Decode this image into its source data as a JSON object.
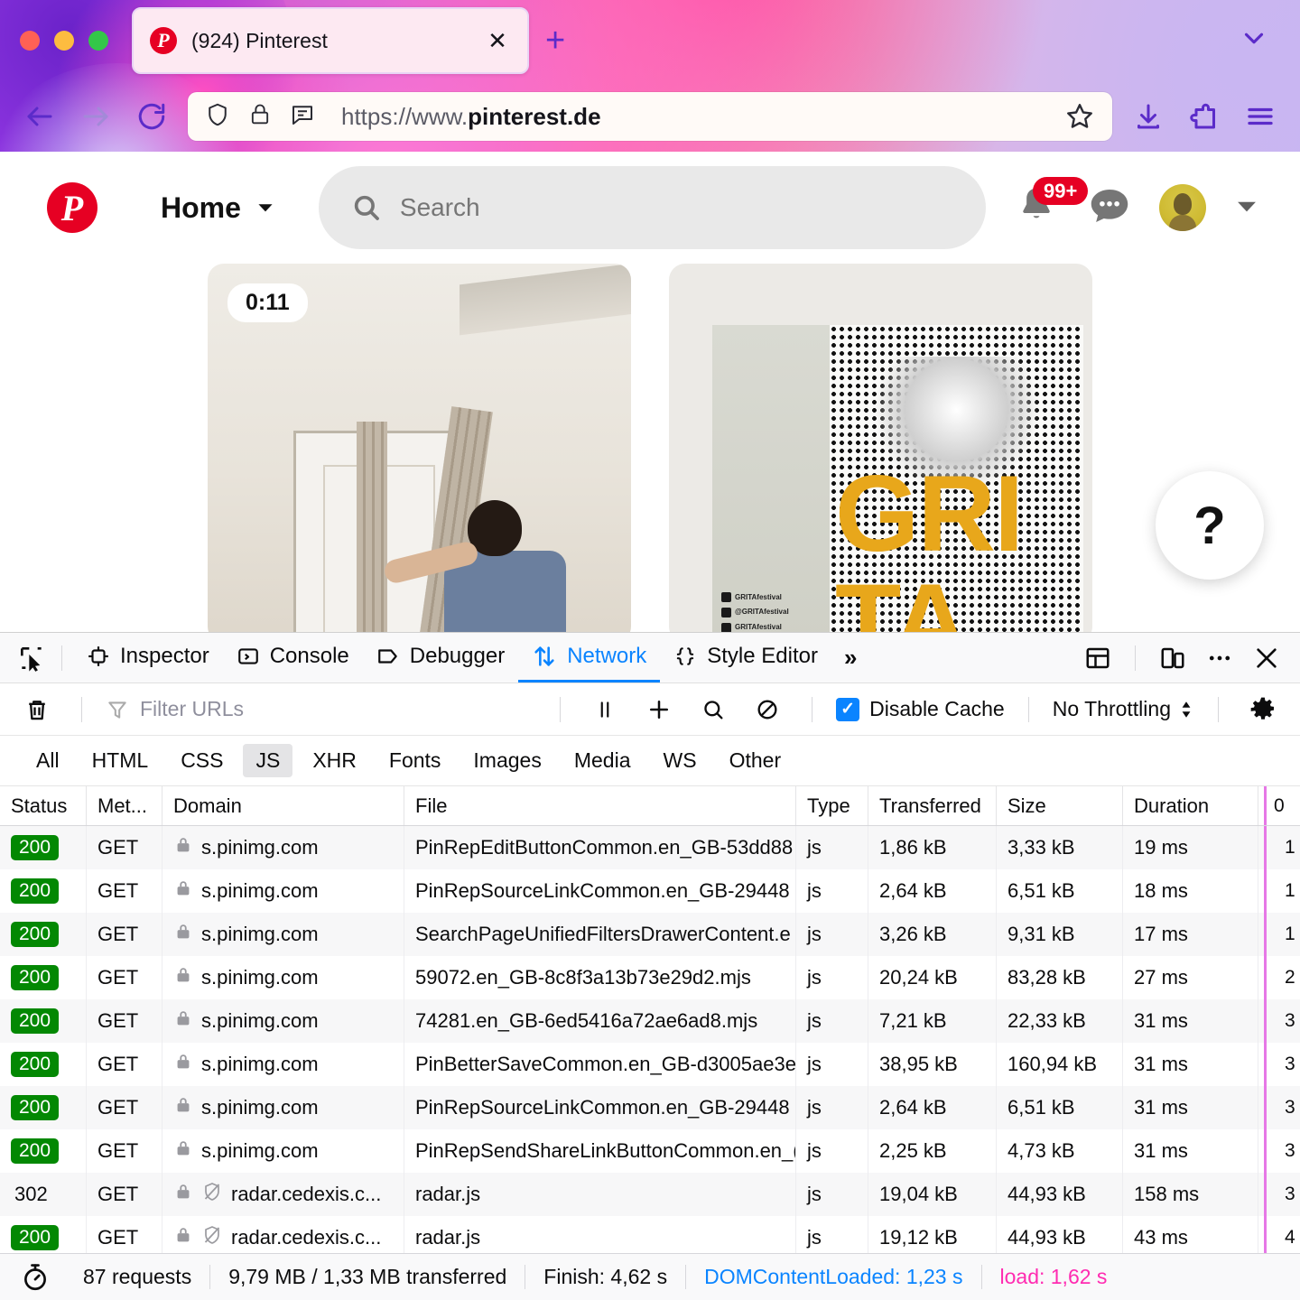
{
  "browser": {
    "tab": {
      "title": "(924) Pinterest",
      "favicon": "pinterest-icon",
      "close": "✕"
    },
    "new_tab_label": "+",
    "url": {
      "prefix": "https://www.",
      "domain": "pinterest.de"
    },
    "nav": {
      "back": "back-icon",
      "forward": "forward-icon",
      "reload": "reload-icon"
    },
    "url_icons": [
      "shield-icon",
      "lock-icon",
      "reader-icon"
    ],
    "toolbar_icons": [
      "bookmark-star-icon",
      "downloads-icon",
      "extensions-icon",
      "app-menu-icon"
    ]
  },
  "pinterest": {
    "home_label": "Home",
    "search_placeholder": "Search",
    "notifications_badge": "99+",
    "pins": [
      {
        "duration": "0:11",
        "type": "video"
      },
      {
        "poster_text_1": "GRI",
        "poster_text_2": "TA",
        "socials": [
          "GRITAfestival",
          "@GRITAfestival",
          "GRITAfestival"
        ]
      }
    ],
    "help_label": "?"
  },
  "devtools": {
    "tabs": [
      {
        "label": "Inspector",
        "icon": "inspector-icon",
        "active": false
      },
      {
        "label": "Console",
        "icon": "console-icon",
        "active": false
      },
      {
        "label": "Debugger",
        "icon": "debugger-icon",
        "active": false
      },
      {
        "label": "Network",
        "icon": "network-icon",
        "active": true
      },
      {
        "label": "Style Editor",
        "icon": "style-editor-icon",
        "active": false
      }
    ],
    "more_tabs": "»",
    "right_icons": [
      "dock-layout-icon",
      "responsive-design-icon",
      "meatball-menu-icon",
      "close-icon"
    ],
    "filter_placeholder": "Filter URLs",
    "disable_cache_label": "Disable Cache",
    "disable_cache_checked": true,
    "throttling_label": "No Throttling",
    "type_filters": [
      "All",
      "HTML",
      "CSS",
      "JS",
      "XHR",
      "Fonts",
      "Images",
      "Media",
      "WS",
      "Other"
    ],
    "active_type_filter": "JS",
    "columns": [
      "Status",
      "Met...",
      "Domain",
      "File",
      "Type",
      "Transferred",
      "Size",
      "Duration",
      "0"
    ],
    "rows": [
      {
        "status": "200",
        "method": "GET",
        "domain": "s.pinimg.com",
        "secure": true,
        "blocked": false,
        "file": "PinRepEditButtonCommon.en_GB-53dd88",
        "type": "js",
        "transferred": "1,86 kB",
        "size": "3,33 kB",
        "duration": "19 ms",
        "wf_color": "#8e9bb3",
        "wf_num": "1"
      },
      {
        "status": "200",
        "method": "GET",
        "domain": "s.pinimg.com",
        "secure": true,
        "blocked": false,
        "file": "PinRepSourceLinkCommon.en_GB-29448",
        "type": "js",
        "transferred": "2,64 kB",
        "size": "6,51 kB",
        "duration": "18 ms",
        "wf_color": "#8e9bb3",
        "wf_num": "1"
      },
      {
        "status": "200",
        "method": "GET",
        "domain": "s.pinimg.com",
        "secure": true,
        "blocked": false,
        "file": "SearchPageUnifiedFiltersDrawerContent.e",
        "type": "js",
        "transferred": "3,26 kB",
        "size": "9,31 kB",
        "duration": "17 ms",
        "wf_color": "#8e9bb3",
        "wf_num": "1"
      },
      {
        "status": "200",
        "method": "GET",
        "domain": "s.pinimg.com",
        "secure": true,
        "blocked": false,
        "file": "59072.en_GB-8c8f3a13b73e29d2.mjs",
        "type": "js",
        "transferred": "20,24 kB",
        "size": "83,28 kB",
        "duration": "27 ms",
        "wf_color": "#5bb55b",
        "wf_num": "2"
      },
      {
        "status": "200",
        "method": "GET",
        "domain": "s.pinimg.com",
        "secure": true,
        "blocked": false,
        "file": "74281.en_GB-6ed5416a72ae6ad8.mjs",
        "type": "js",
        "transferred": "7,21 kB",
        "size": "22,33 kB",
        "duration": "31 ms",
        "wf_color": "#5bb55b",
        "wf_num": "3"
      },
      {
        "status": "200",
        "method": "GET",
        "domain": "s.pinimg.com",
        "secure": true,
        "blocked": false,
        "file": "PinBetterSaveCommon.en_GB-d3005ae3e",
        "type": "js",
        "transferred": "38,95 kB",
        "size": "160,94 kB",
        "duration": "31 ms",
        "wf_color": "#5bb55b",
        "wf_num": "3"
      },
      {
        "status": "200",
        "method": "GET",
        "domain": "s.pinimg.com",
        "secure": true,
        "blocked": false,
        "file": "PinRepSourceLinkCommon.en_GB-29448",
        "type": "js",
        "transferred": "2,64 kB",
        "size": "6,51 kB",
        "duration": "31 ms",
        "wf_color": "#8e9bb3",
        "wf_num": "3"
      },
      {
        "status": "200",
        "method": "GET",
        "domain": "s.pinimg.com",
        "secure": true,
        "blocked": false,
        "file": "PinRepSendShareLinkButtonCommon.en_(",
        "type": "js",
        "transferred": "2,25 kB",
        "size": "4,73 kB",
        "duration": "31 ms",
        "wf_color": "#8e9bb3",
        "wf_num": "3"
      },
      {
        "status": "302",
        "method": "GET",
        "domain": "radar.cedexis.c...",
        "secure": true,
        "blocked": true,
        "file": "radar.js",
        "type": "js",
        "transferred": "19,04 kB",
        "size": "44,93 kB",
        "duration": "158 ms",
        "wf_color": "#d94a28",
        "wf_num": "3"
      },
      {
        "status": "200",
        "method": "GET",
        "domain": "radar.cedexis.c...",
        "secure": true,
        "blocked": true,
        "file": "radar.js",
        "type": "js",
        "transferred": "19,12 kB",
        "size": "44,93 kB",
        "duration": "43 ms",
        "wf_color": "#8e9bb3",
        "wf_num": "4"
      }
    ],
    "status_bar": {
      "requests": "87 requests",
      "transferred": "9,79 MB / 1,33 MB transferred",
      "finish": "Finish: 4,62 s",
      "dom_content_loaded": "DOMContentLoaded: 1,23 s",
      "load": "load: 1,62 s"
    }
  },
  "colors": {
    "accent_blue": "#0a84ff",
    "pinterest_red": "#e60023",
    "status_green": "#038803",
    "load_pink": "#ff2bb1",
    "waterfall_line": "#e678e6"
  }
}
